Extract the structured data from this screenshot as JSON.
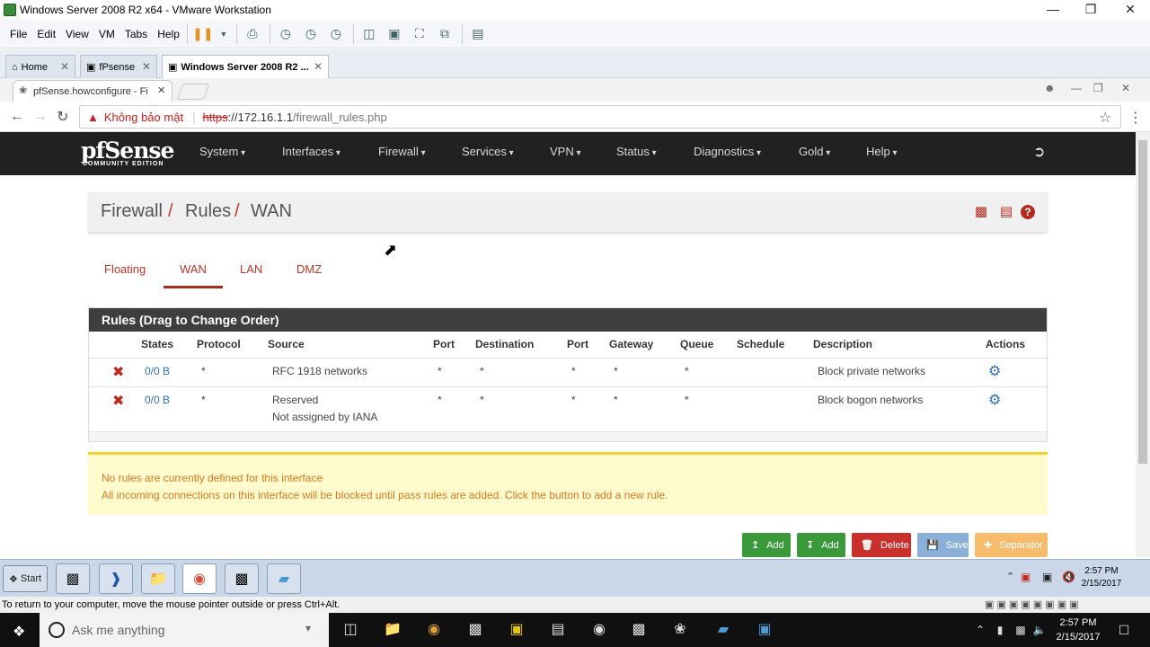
{
  "vmware": {
    "title": "Windows Server 2008 R2 x64 - VMware Workstation",
    "menu": [
      "File",
      "Edit",
      "View",
      "VM",
      "Tabs",
      "Help"
    ],
    "tabs": [
      {
        "label": "Home"
      },
      {
        "label": "fPsense"
      },
      {
        "label": "Windows Server 2008 R2 ..."
      }
    ],
    "status_text": "To return to your computer, move the mouse pointer outside or press Ctrl+Alt."
  },
  "browser": {
    "tab_title": "pfSense.howconfigure - Fi",
    "security_label": "Không bảo mật",
    "url_scheme": "https",
    "url_host": "://172.16.1.1",
    "url_path": "/firewall_rules.php"
  },
  "pfsense": {
    "logo": "pfSense",
    "logo_sub": "COMMUNITY EDITION",
    "nav": [
      "System",
      "Interfaces",
      "Firewall",
      "Services",
      "VPN",
      "Status",
      "Diagnostics",
      "Gold",
      "Help"
    ],
    "breadcrumb": [
      "Firewall",
      "Rules",
      "WAN"
    ],
    "interface_tabs": [
      "Floating",
      "WAN",
      "LAN",
      "DMZ"
    ],
    "active_tab": "WAN",
    "panel_title": "Rules (Drag to Change Order)",
    "columns": [
      "States",
      "Protocol",
      "Source",
      "Port",
      "Destination",
      "Port",
      "Gateway",
      "Queue",
      "Schedule",
      "Description",
      "Actions"
    ],
    "rules": [
      {
        "states": "0/0 B",
        "protocol": "*",
        "source": "RFC 1918 networks",
        "source2": "",
        "port": "*",
        "destination": "*",
        "dport": "*",
        "gateway": "*",
        "queue": "*",
        "schedule": "",
        "description": "Block private networks"
      },
      {
        "states": "0/0 B",
        "protocol": "*",
        "source": "Reserved",
        "source2": "Not assigned by IANA",
        "port": "*",
        "destination": "*",
        "dport": "*",
        "gateway": "*",
        "queue": "*",
        "schedule": "",
        "description": "Block bogon networks"
      }
    ],
    "alert_line1": "No rules are currently defined for this interface",
    "alert_line2": "All incoming connections on this interface will be blocked until pass rules are added. Click the button to add a new rule.",
    "buttons": [
      "Add",
      "Add",
      "Delete",
      "Save",
      "Separator"
    ]
  },
  "guest_taskbar": {
    "start": "Start",
    "time": "2:57 PM",
    "date": "2/15/2017"
  },
  "host_taskbar": {
    "search_placeholder": "Ask me anything",
    "time": "2:57 PM",
    "date": "2/15/2017"
  }
}
